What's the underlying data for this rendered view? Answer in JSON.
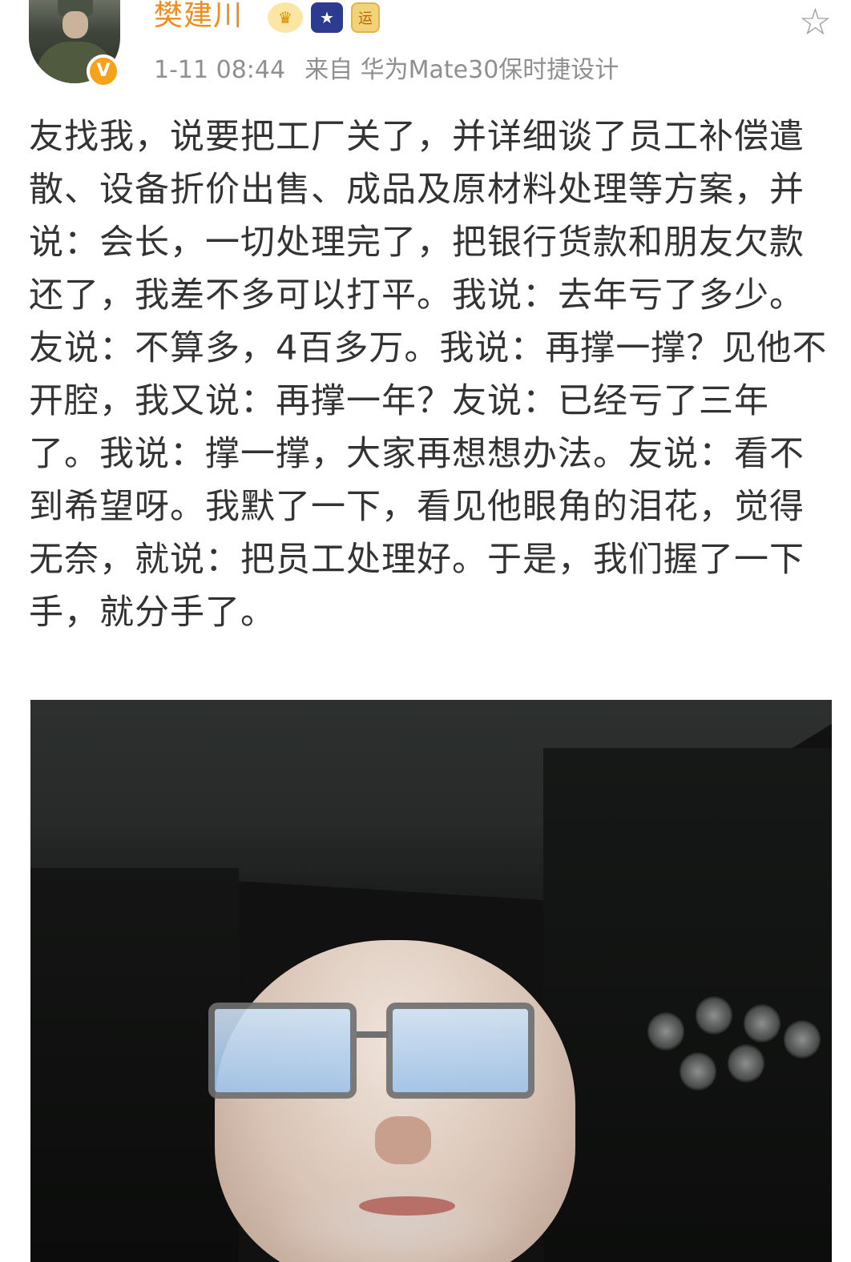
{
  "header": {
    "username": "樊建川",
    "verified_badge": "V",
    "badges": [
      "crown-icon",
      "shooting-star-icon",
      "yun-badge-icon"
    ],
    "yun_badge_text": "运",
    "timestamp": "1-11 08:44",
    "source": "来自 华为Mate30保时捷设计"
  },
  "post": {
    "text": "友找我，说要把工厂关了，并详细谈了员工补偿遣散、设备折价出售、成品及原材料处理等方案，并说：会长，一切处理完了，把银行货款和朋友欠款还了，我差不多可以打平。我说：去年亏了多少。友说：不算多，4百多万。我说：再撑一撑？见他不开腔，我又说：再撑一年？友说：已经亏了三年了。我说：撑一撑，大家再想想办法。友说：看不到希望呀。我默了一下，看见他眼角的泪花，觉得无奈，就说：把员工处理好。于是，我们握了一下手，就分手了。"
  },
  "colors": {
    "username": "#f28c1c",
    "meta": "#8f8f8f",
    "text": "#333333",
    "verified": "#f7a21b"
  }
}
